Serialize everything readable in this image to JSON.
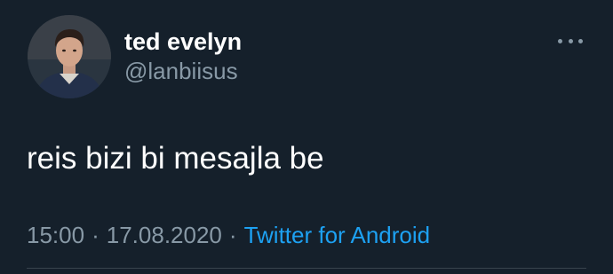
{
  "user": {
    "display_name": "ted evelyn",
    "handle": "@lanbiisus",
    "avatar_icon": "profile-photo"
  },
  "more_icon": "more-horizontal-icon",
  "tweet": {
    "text": "reis bizi bi mesajla be",
    "time": "15:00",
    "separator": "·",
    "date": "17.08.2020",
    "source": "Twitter for Android"
  },
  "colors": {
    "background": "#15202b",
    "primary_text": "#ffffff",
    "secondary_text": "#8899a6",
    "link": "#1da1f2",
    "divider": "#38444d"
  }
}
